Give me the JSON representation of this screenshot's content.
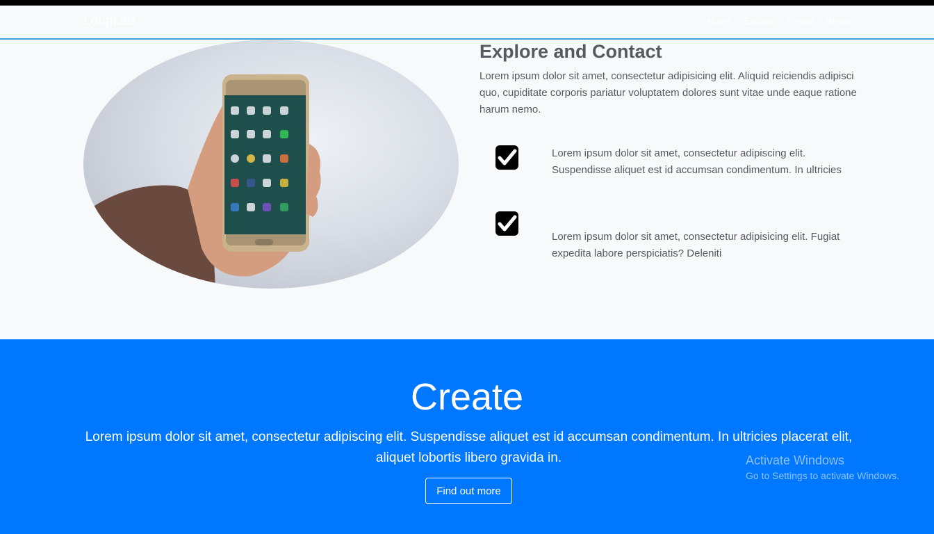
{
  "nav": {
    "brand": "LoopLab",
    "links": [
      "Home",
      "Explore",
      "Create",
      "Share"
    ]
  },
  "explore": {
    "title": "Explore and Contact",
    "description": "Lorem ipsum dolor sit amet, consectetur adipisicing elit. Aliquid reiciendis adipisci quo, cupiditate corporis pariatur voluptatem dolores sunt vitae unde eaque ratione harum nemo.",
    "features": [
      {
        "icon": "check-square-icon",
        "text": "Lorem ipsum dolor sit amet, consectetur adipiscing elit. Suspendisse aliquet est id accumsan condimentum. In ultricies"
      },
      {
        "icon": "check-square-icon",
        "text": "Lorem ipsum dolor sit amet, consectetur adipisicing elit. Fugiat expedita labore perspiciatis? Deleniti"
      }
    ]
  },
  "create": {
    "title": "Create",
    "description": "Lorem ipsum dolor sit amet, consectetur adipiscing elit. Suspendisse aliquet est id accumsan condimentum. In ultricies placerat elit, aliquet lobortis libero gravida in.",
    "button_label": "Find out more"
  },
  "watermark": {
    "title": "Activate Windows",
    "subtitle": "Go to Settings to activate Windows."
  },
  "colors": {
    "accent_blue": "#0077ff",
    "nav_underline": "#3aa0e0",
    "text_gray": "#555a60",
    "page_bg": "#f8f9fa"
  }
}
